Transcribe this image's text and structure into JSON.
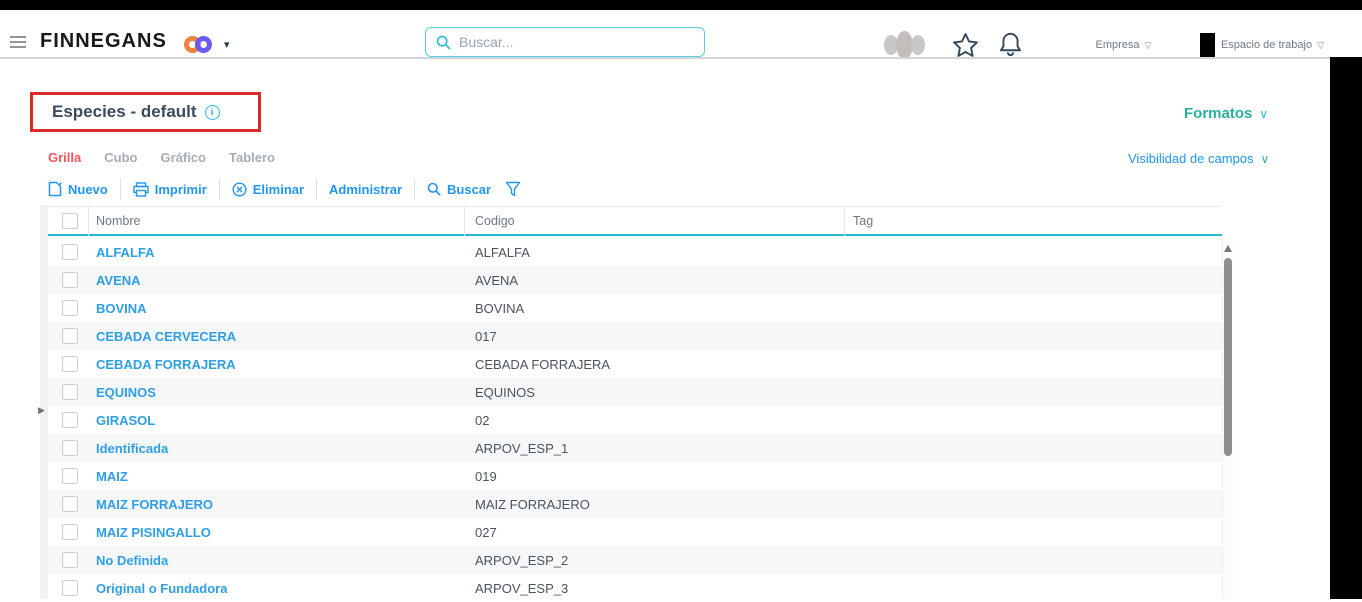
{
  "topbar": {
    "brand": "FINNEGANS",
    "brand_caret": "▾",
    "search_placeholder": "Buscar...",
    "empresa_label": "Empresa",
    "workspace_label": "Espacio de trabajo",
    "dropdown_glyph": "▽"
  },
  "page": {
    "title": "Especies - default",
    "info_glyph": "i",
    "formatos_label": "Formatos",
    "visibility_label": "Visibilidad de campos",
    "chevron_glyph": "∨"
  },
  "tabs": [
    {
      "label": "Grilla",
      "active": true
    },
    {
      "label": "Cubo",
      "active": false
    },
    {
      "label": "Gráfico",
      "active": false
    },
    {
      "label": "Tablero",
      "active": false
    }
  ],
  "toolbar": {
    "nuevo": "Nuevo",
    "imprimir": "Imprimir",
    "eliminar": "Eliminar",
    "administrar": "Administrar",
    "buscar": "Buscar"
  },
  "left_panel": {
    "handle_glyph": "▶"
  },
  "table": {
    "columns": [
      "Nombre",
      "Codigo",
      "Tag"
    ],
    "rows": [
      {
        "nombre": "ALFALFA",
        "codigo": "ALFALFA",
        "tag": ""
      },
      {
        "nombre": "AVENA",
        "codigo": "AVENA",
        "tag": ""
      },
      {
        "nombre": "BOVINA",
        "codigo": "BOVINA",
        "tag": ""
      },
      {
        "nombre": "CEBADA CERVECERA",
        "codigo": "017",
        "tag": ""
      },
      {
        "nombre": "CEBADA FORRAJERA",
        "codigo": "CEBADA FORRAJERA",
        "tag": ""
      },
      {
        "nombre": "EQUINOS",
        "codigo": "EQUINOS",
        "tag": ""
      },
      {
        "nombre": "GIRASOL",
        "codigo": "02",
        "tag": ""
      },
      {
        "nombre": "Identificada",
        "codigo": "ARPOV_ESP_1",
        "tag": ""
      },
      {
        "nombre": "MAIZ",
        "codigo": "019",
        "tag": ""
      },
      {
        "nombre": "MAIZ FORRAJERO",
        "codigo": "MAIZ FORRAJERO",
        "tag": ""
      },
      {
        "nombre": "MAIZ PISINGALLO",
        "codigo": "027",
        "tag": ""
      },
      {
        "nombre": "No Definida",
        "codigo": "ARPOV_ESP_2",
        "tag": ""
      },
      {
        "nombre": "Original o Fundadora",
        "codigo": "ARPOV_ESP_3",
        "tag": ""
      }
    ]
  },
  "icons": {
    "hamburger": "menu-icon",
    "logo_rings": "infinity-logo-icon",
    "search": "magnifier-icon",
    "apps_blob": "apps-blob-icon",
    "favorites": "star-icon",
    "notifications": "bell-icon",
    "info": "info-icon",
    "new_doc": "new-document-icon",
    "printer": "printer-icon",
    "delete": "delete-circle-icon",
    "filter": "filter-funnel-icon"
  },
  "colors": {
    "accent_blue": "#2196f3",
    "link_blue": "#2e9fe6",
    "cyan_border": "#27b7d9",
    "search_border": "#56d0e0",
    "teal_formatos": "#29b09b",
    "tab_active_red": "#f4555e",
    "annotation_red": "#d92b25",
    "title_slate": "#3d4b5f",
    "muted_gray": "#6e7a87",
    "logo_orange": "#f0823f",
    "logo_purple": "#6a5cf0",
    "alt_row": "#f6f7f8"
  }
}
